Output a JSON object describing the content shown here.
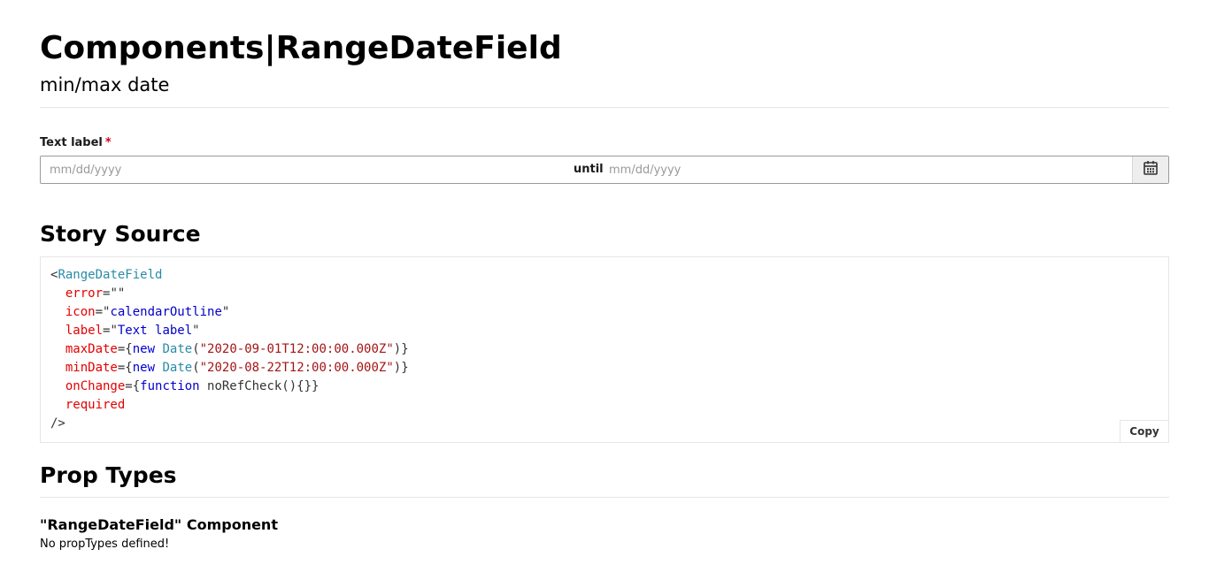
{
  "header": {
    "title": "Components|RangeDateField",
    "subtitle": "min/max date"
  },
  "field": {
    "label": "Text label",
    "required_mark": "*",
    "start_placeholder": "mm/dd/yyyy",
    "until_label": "until",
    "end_placeholder": "mm/dd/yyyy",
    "icon": "calendar-icon"
  },
  "story_source": {
    "heading": "Story Source",
    "code": {
      "open_bracket": "<",
      "component": "RangeDateField",
      "error_attr": "error",
      "error_value": "\"\"",
      "icon_attr": "icon",
      "icon_value": "calendarOutline",
      "label_attr": "label",
      "label_value": "Text label",
      "maxdate_attr": "maxDate",
      "maxdate_value": "\"2020-09-01T12:00:00.000Z\"",
      "mindate_attr": "minDate",
      "mindate_value": "\"2020-08-22T12:00:00.000Z\"",
      "onchange_attr": "onChange",
      "onchange_body": " noRefCheck(){}}",
      "required_attr": "required",
      "close": "/>",
      "keyword_new": "new",
      "keyword_date": "Date",
      "keyword_function": "function"
    },
    "copy_label": "Copy"
  },
  "prop_types": {
    "heading": "Prop Types",
    "component_heading": "\"RangeDateField\" Component",
    "message": "No propTypes defined!"
  }
}
